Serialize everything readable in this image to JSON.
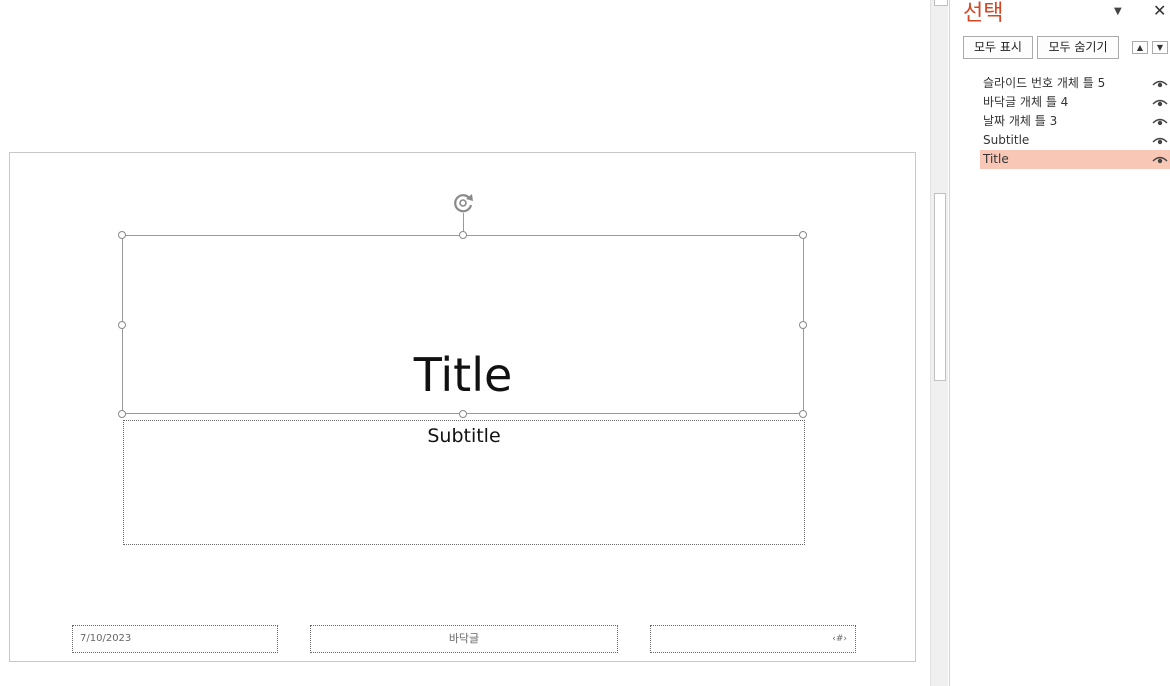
{
  "slide": {
    "title": "Title",
    "subtitle": "Subtitle",
    "footer_date": "7/10/2023",
    "footer_text": "바닥글",
    "footer_number": "‹#›"
  },
  "selection_pane": {
    "title": "선택",
    "show_all_label": "모두 표시",
    "hide_all_label": "모두 숨기기",
    "items": [
      {
        "label": "슬라이드 번호 개체 틀 5",
        "selected": false,
        "visible": true
      },
      {
        "label": "바닥글 개체 틀 4",
        "selected": false,
        "visible": true
      },
      {
        "label": "날짜 개체 틀 3",
        "selected": false,
        "visible": true
      },
      {
        "label": "Subtitle",
        "selected": false,
        "visible": true
      },
      {
        "label": "Title",
        "selected": true,
        "visible": true
      }
    ]
  },
  "icons": {
    "menu": "dropdown-arrow-icon",
    "close": "close-icon",
    "bring_forward": "arrow-up-icon",
    "send_backward": "arrow-down-icon",
    "visibility": "eye-icon",
    "rotate": "rotate-icon"
  },
  "colors": {
    "pane_title": "#d24726",
    "selected_item": "#f9c7b6"
  }
}
